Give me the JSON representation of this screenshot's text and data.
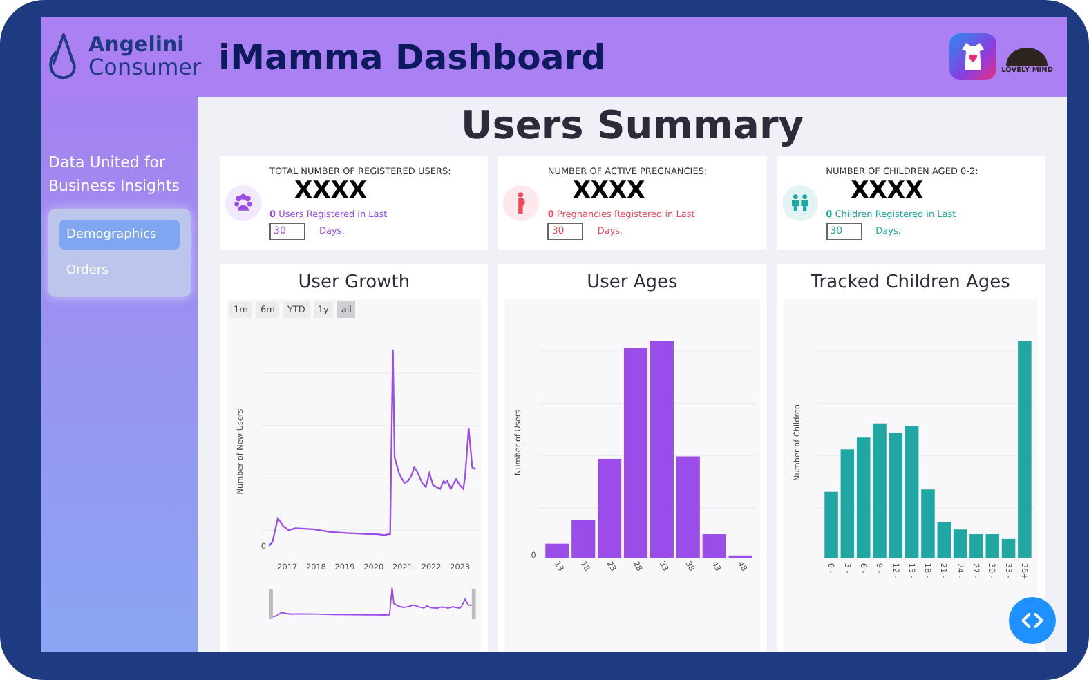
{
  "header": {
    "brand_top": "Angelini",
    "brand_bottom": "Consumer",
    "title": "iMamma Dashboard",
    "partner_logo_text": "LOVELY MIND"
  },
  "sidebar": {
    "tagline": "Data United for Business Insights",
    "items": [
      {
        "label": "Demographics",
        "selected": true
      },
      {
        "label": "Orders",
        "selected": false
      }
    ]
  },
  "page_title": "Users Summary",
  "stats": [
    {
      "kind": "users",
      "label": "TOTAL NUMBER OF REGISTERED USERS:",
      "value": "XXXX",
      "caption": "**0** Users Registered in Last",
      "days": "30",
      "unit": "Days.",
      "color": "#9b4dea"
    },
    {
      "kind": "pregnancy",
      "label": "NUMBER OF ACTIVE PREGNANCIES:",
      "value": "XXXX",
      "caption": "**0** Pregnancies Registered in Last",
      "days": "30",
      "unit": "Days.",
      "color": "#f04a5a"
    },
    {
      "kind": "children",
      "label": "NUMBER OF CHILDREN AGED 0-2:",
      "value": "XXXX",
      "caption": "**0** Children Registered in Last",
      "days": "30",
      "unit": "Days.",
      "color": "#20a6a3"
    }
  ],
  "charts": [
    {
      "kind": "line",
      "title": "User Growth",
      "ylabel": "Number of New Users",
      "y_zero": "0",
      "x_labels": [
        "2017",
        "2018",
        "2019",
        "2020",
        "2021",
        "2022",
        "2023"
      ],
      "range_buttons": [
        {
          "label": "1m",
          "selected": false
        },
        {
          "label": "6m",
          "selected": false
        },
        {
          "label": "YTD",
          "selected": false
        },
        {
          "label": "1y",
          "selected": false
        },
        {
          "label": "all",
          "selected": true
        }
      ]
    },
    {
      "kind": "bar",
      "title": "User Ages",
      "ylabel": "Number of Users",
      "y_zero": "0",
      "x_labels": [
        "13",
        "18",
        "23",
        "28",
        "33",
        "38",
        "43",
        "48"
      ]
    },
    {
      "kind": "bar",
      "title": "Tracked Children Ages",
      "ylabel": "Number of Children",
      "x_labels": [
        "0 -",
        "3 -",
        "6 -",
        "9 -",
        "12 -",
        "15 -",
        "18 -",
        "21 -",
        "24 -",
        "27 -",
        "30 -",
        "33 -",
        "36+"
      ]
    }
  ]
}
